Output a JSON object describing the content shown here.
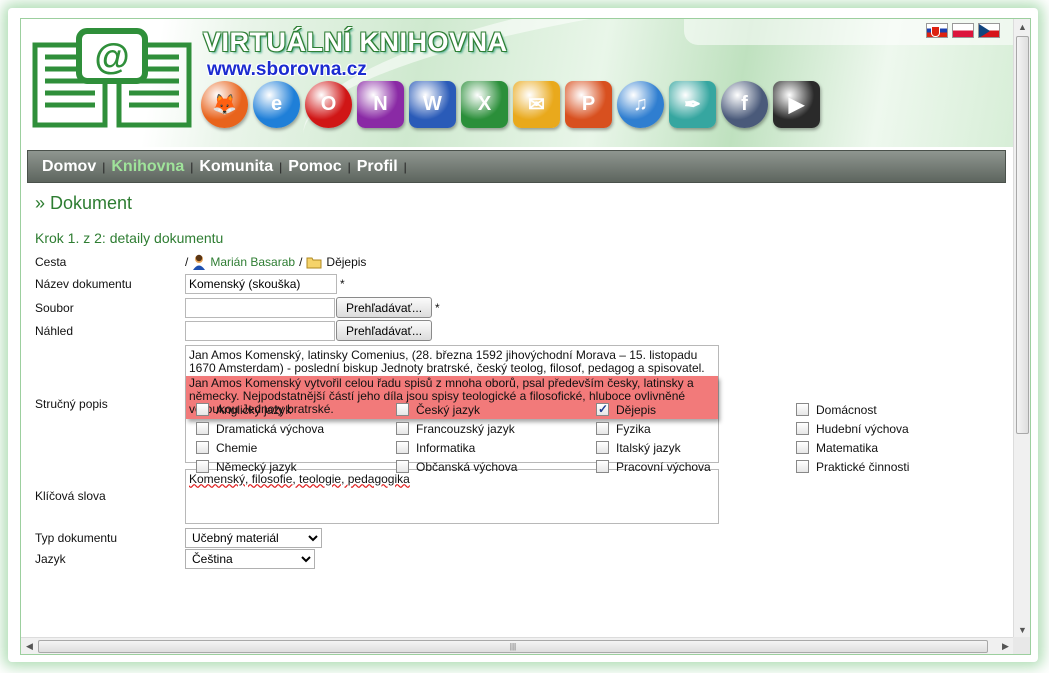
{
  "header": {
    "site_title": "VIRTUÁLNÍ KNIHOVNA",
    "site_url": "www.sborovna.cz",
    "flags": [
      "slovak-flag",
      "polish-flag",
      "czech-flag"
    ],
    "app_icons": [
      {
        "name": "firefox-icon",
        "glyph": "🦊",
        "color": "#e8631c"
      },
      {
        "name": "internet-explorer-icon",
        "glyph": "e",
        "color": "#1f7fd8"
      },
      {
        "name": "opera-icon",
        "glyph": "O",
        "color": "#d01616"
      },
      {
        "name": "onenote-icon",
        "glyph": "N",
        "color": "#8a2aa5"
      },
      {
        "name": "word-icon",
        "glyph": "W",
        "color": "#2a5bb8"
      },
      {
        "name": "excel-icon",
        "glyph": "X",
        "color": "#2b8f3a"
      },
      {
        "name": "outlook-icon",
        "glyph": "✉",
        "color": "#e9a91c"
      },
      {
        "name": "powerpoint-icon",
        "glyph": "P",
        "color": "#d8501f"
      },
      {
        "name": "music-cd-icon",
        "glyph": "♫",
        "color": "#2f7ed0"
      },
      {
        "name": "feather-icon",
        "glyph": "✒",
        "color": "#36a6a0"
      },
      {
        "name": "flash-icon",
        "glyph": "f",
        "color": "#4a5a7a"
      },
      {
        "name": "avi-video-icon",
        "glyph": "▶",
        "color": "#2a2a2a"
      }
    ]
  },
  "nav": {
    "items": [
      "Domov",
      "Knihovna",
      "Komunita",
      "Pomoc",
      "Profil"
    ],
    "active": "Knihovna"
  },
  "page": {
    "heading": "» Dokument",
    "step": "Krok 1. z 2: detaily dokumentu"
  },
  "form": {
    "path_label": "Cesta",
    "path_user": "Marián Basarab",
    "path_folder": "Dějepis",
    "path_sep": "/",
    "name_label": "Název dokumentu",
    "name_value": "Komenský (skouška)",
    "required_mark": "*",
    "file_label": "Soubor",
    "preview_label": "Náhled",
    "browse_button": "Prehľadávať...",
    "summary_label": "Stručný popis",
    "summary_text_1": "Jan Amos Komenský, latinsky Comenius, (28. března 1592  jihovýchodní Morava – 15. listopadu 1670  Amsterdam) - poslední biskup Jednoty bratrské, český teolog, filosof, pedagog  a spisovatel.",
    "summary_text_2": "Jan Amos Komenský vytvořil celou řadu spisů z mnoha oborů, psal především česky, latinsky a německy. Nejpodstatnější částí jeho díla jsou spisy teologické a filosofické, hluboce ovlivněné věroukou Jednoty bratrské.",
    "keywords_label": "Klíčová slova",
    "keywords_value": "Komenský, filosofie, teologie, pedagogika",
    "type_label": "Typ dokumentu",
    "type_value": "Učebný materiál",
    "lang_label": "Jazyk",
    "lang_value": "Čeština"
  },
  "subjects": [
    {
      "label": "Anglický jazyk",
      "checked": false
    },
    {
      "label": "Český jazyk",
      "checked": false
    },
    {
      "label": "Dějepis",
      "checked": true
    },
    {
      "label": "Domácnost",
      "checked": false
    },
    {
      "label": "Dramatická výchova",
      "checked": false
    },
    {
      "label": "Francouzský jazyk",
      "checked": false
    },
    {
      "label": "Fyzika",
      "checked": false
    },
    {
      "label": "Hudební výchova",
      "checked": false
    },
    {
      "label": "Chemie",
      "checked": false
    },
    {
      "label": "Informatika",
      "checked": false
    },
    {
      "label": "Italský jazyk",
      "checked": false
    },
    {
      "label": "Matematika",
      "checked": false
    },
    {
      "label": "Německý jazyk",
      "checked": false
    },
    {
      "label": "Občanská výchova",
      "checked": false
    },
    {
      "label": "Pracovní výchova",
      "checked": false
    },
    {
      "label": "Praktické činnosti",
      "checked": false
    }
  ]
}
